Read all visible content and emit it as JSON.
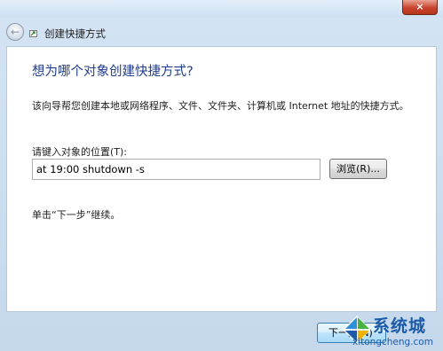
{
  "window": {
    "title": "创建快捷方式",
    "close_glyph": "×"
  },
  "nav": {
    "back_glyph": "←"
  },
  "wizard": {
    "heading": "想为哪个对象创建快捷方式?",
    "description": "该向导帮您创建本地或网络程序、文件、文件夹、计算机或 Internet 地址的快捷方式。",
    "location_label": "请键入对象的位置(T):",
    "location_value": "at 19:00 shutdown -s",
    "browse_label": "浏览(R)...",
    "hint": "单击“下一步”继续。"
  },
  "footer": {
    "next_label": "下一步(N)"
  },
  "watermark": {
    "brand": "系统城",
    "url": "xitongcheng.com"
  },
  "colors": {
    "heading": "#1f3c8c",
    "close": "#c8442f",
    "watermark": "#1a5aa8"
  }
}
